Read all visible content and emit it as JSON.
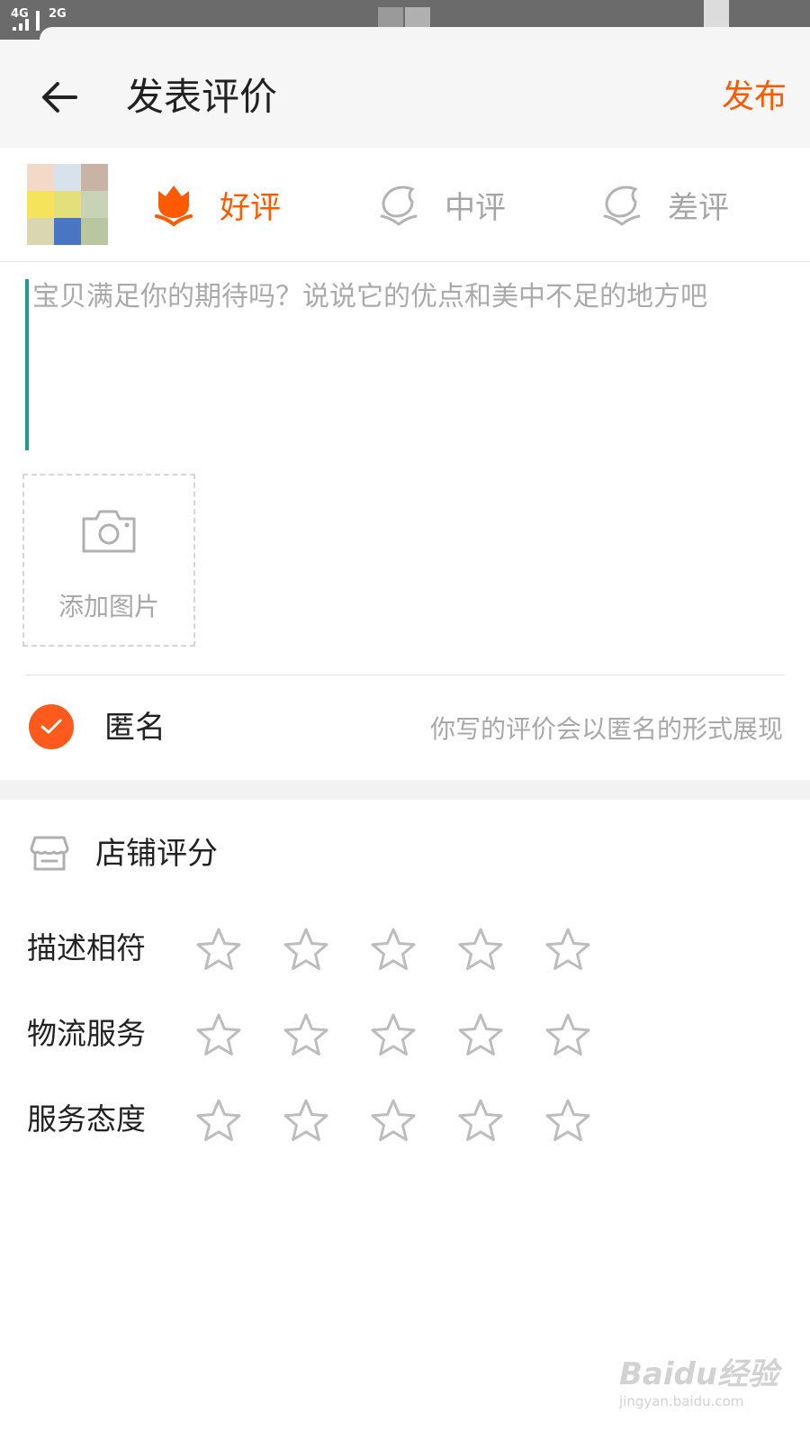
{
  "status_bar": {
    "net1": "4G",
    "net2": "2G"
  },
  "header": {
    "title": "发表评价",
    "publish_label": "发布"
  },
  "rating": {
    "options": [
      {
        "label": "好评",
        "selected": true
      },
      {
        "label": "中评",
        "selected": false
      },
      {
        "label": "差评",
        "selected": false
      }
    ]
  },
  "review": {
    "placeholder": "宝贝满足你的期待吗？说说它的优点和美中不足的地方吧",
    "value": ""
  },
  "add_photo": {
    "label": "添加图片"
  },
  "anonymous": {
    "label": "匿名",
    "hint": "你写的评价会以匿名的形式展现",
    "checked": true
  },
  "shop_rating": {
    "title": "店铺评分",
    "rows": [
      {
        "label": "描述相符",
        "stars": 0,
        "max": 5
      },
      {
        "label": "物流服务",
        "stars": 0,
        "max": 5
      },
      {
        "label": "服务态度",
        "stars": 0,
        "max": 5
      }
    ]
  },
  "watermark": {
    "line1": "Baidu经验",
    "line2": "jingyan.baidu.com"
  },
  "colors": {
    "accent": "#ff5a00",
    "inactive_icon": "#b3b3b3",
    "check_bg": "#ff5a1e",
    "text": "#222222",
    "hint": "#a8a8a8"
  }
}
